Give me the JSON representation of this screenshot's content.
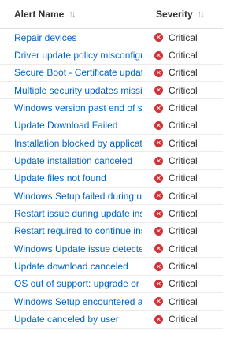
{
  "header": {
    "alert_name": "Alert Name",
    "severity": "Severity",
    "sort_icon": "sort-arrows-icon"
  },
  "colors": {
    "link": "#0064c8",
    "critical": "#d13438",
    "divider": "#edebe9"
  },
  "rows": [
    {
      "name": "Repair devices",
      "severity": "Critical"
    },
    {
      "name": "Driver update policy misconfigured",
      "severity": "Critical"
    },
    {
      "name": "Secure Boot - Certificate update required",
      "severity": "Critical"
    },
    {
      "name": "Multiple security updates missing",
      "severity": "Critical"
    },
    {
      "name": "Windows version past end of service",
      "severity": "Critical"
    },
    {
      "name": "Update Download Failed",
      "severity": "Critical"
    },
    {
      "name": "Installation blocked by application or driver",
      "severity": "Critical"
    },
    {
      "name": "Update installation canceled",
      "severity": "Critical"
    },
    {
      "name": "Update files not found",
      "severity": "Critical"
    },
    {
      "name": "Windows Setup failed during update",
      "severity": "Critical"
    },
    {
      "name": "Restart issue during update installation",
      "severity": "Critical"
    },
    {
      "name": "Restart required to continue installation",
      "severity": "Critical"
    },
    {
      "name": "Windows Update issue detected",
      "severity": "Critical"
    },
    {
      "name": "Update download canceled",
      "severity": "Critical"
    },
    {
      "name": "OS out of support: upgrade or get Extended Security Updates",
      "severity": "Critical"
    },
    {
      "name": "Windows Setup encountered an error",
      "severity": "Critical"
    },
    {
      "name": "Update canceled by user",
      "severity": "Critical"
    }
  ]
}
